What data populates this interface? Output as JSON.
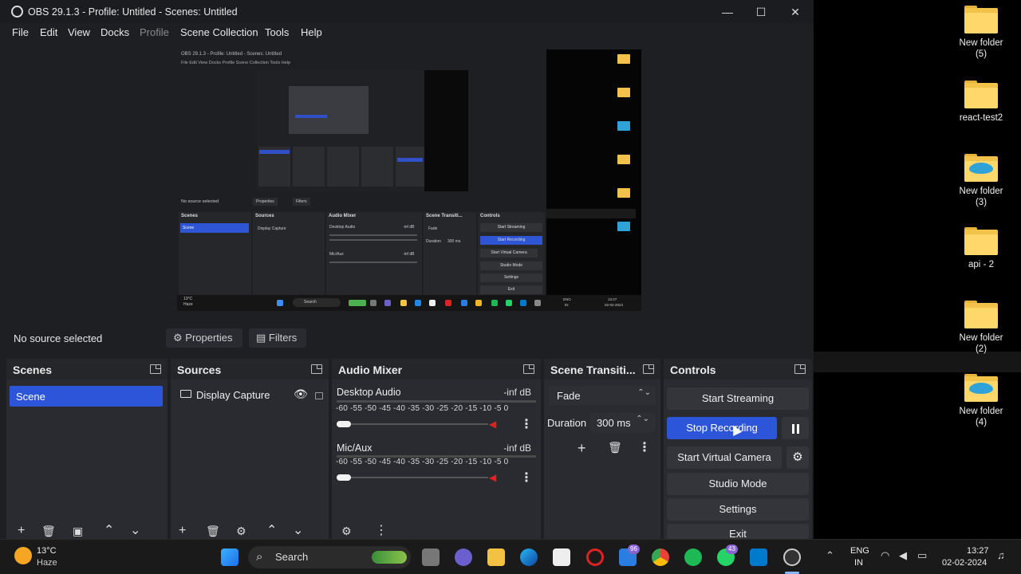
{
  "window": {
    "title": "OBS 29.1.3 - Profile: Untitled - Scenes: Untitled",
    "controls": {
      "minimize": "—",
      "maximize": "☐",
      "close": "✕"
    }
  },
  "menu": [
    "File",
    "Edit",
    "View",
    "Docks",
    "Profile",
    "Scene Collection",
    "Tools",
    "Help"
  ],
  "preview_inner": {
    "title": "OBS 29.1.3 - Profile: Untitled - Scenes: Untitled",
    "menu": "File  Edit  View  Docks  Profile  Scene Collection  Tools  Help",
    "no_source": "No source selected",
    "properties": "Properties",
    "filters": "Filters",
    "scenes": "Scenes",
    "scene": "Scene",
    "sources": "Sources",
    "display_capture": "Display Capture",
    "audio_mixer": "Audio Mixer",
    "desktop_audio": "Desktop Audio",
    "mic_aux": "Mic/Aux",
    "inf_db": "-inf dB",
    "scene_transitions": "Scene Transiti...",
    "fade": "Fade",
    "duration": "Duration",
    "duration_value": "300 ms",
    "controls": "Controls",
    "start_streaming": "Start Streaming",
    "start_recording": "Start Recording",
    "start_virtual_camera": "Start Virtual Camera",
    "studio_mode": "Studio Mode",
    "settings": "Settings",
    "exit": "Exit",
    "weather_temp": "13°C",
    "weather_desc": "Haze",
    "search": "Search",
    "lang": "ENG",
    "region": "IN",
    "time": "13:27",
    "date": "02-02-2024"
  },
  "source_toolbar": {
    "status": "No source selected",
    "properties": "Properties",
    "filters": "Filters"
  },
  "docks": {
    "scenes": {
      "title": "Scenes",
      "items": [
        "Scene"
      ]
    },
    "sources": {
      "title": "Sources",
      "items": [
        "Display Capture"
      ]
    },
    "mixer": {
      "title": "Audio Mixer",
      "ticks": "-60 -55 -50 -45 -40 -35 -30 -25 -20 -15 -10 -5 0",
      "channels": [
        {
          "name": "Desktop Audio",
          "level": "-inf dB"
        },
        {
          "name": "Mic/Aux",
          "level": "-inf dB"
        }
      ]
    },
    "transitions": {
      "title": "Scene Transiti...",
      "type": "Fade",
      "duration_label": "Duration",
      "duration_value": "300 ms"
    },
    "controls": {
      "title": "Controls",
      "start_streaming": "Start Streaming",
      "stop_recording": "Stop Recording",
      "start_virtual_camera": "Start Virtual Camera",
      "studio_mode": "Studio Mode",
      "settings": "Settings",
      "exit": "Exit"
    }
  },
  "desktop_icons": [
    {
      "label": "New folder\n(5)",
      "kind": "folder-image"
    },
    {
      "label": "react-test2",
      "kind": "folder"
    },
    {
      "label": "New folder\n(3)",
      "kind": "folder-blue"
    },
    {
      "label": "api - 2",
      "kind": "folder-image"
    },
    {
      "label": "New folder\n(2)",
      "kind": "folder"
    },
    {
      "label": "New folder\n(4)",
      "kind": "folder-blue"
    }
  ],
  "taskbar": {
    "weather_temp": "13°C",
    "weather_desc": "Haze",
    "search": "Search",
    "badge_teams": "96",
    "badge_whatsapp": "43",
    "lang": "ENG",
    "region": "IN",
    "time": "13:27",
    "date": "02-02-2024"
  },
  "colors": {
    "accent": "#2d55d9",
    "dock_bg": "#2a2b30",
    "window_bg": "#1e1f22",
    "folder": "#ffd76a"
  }
}
